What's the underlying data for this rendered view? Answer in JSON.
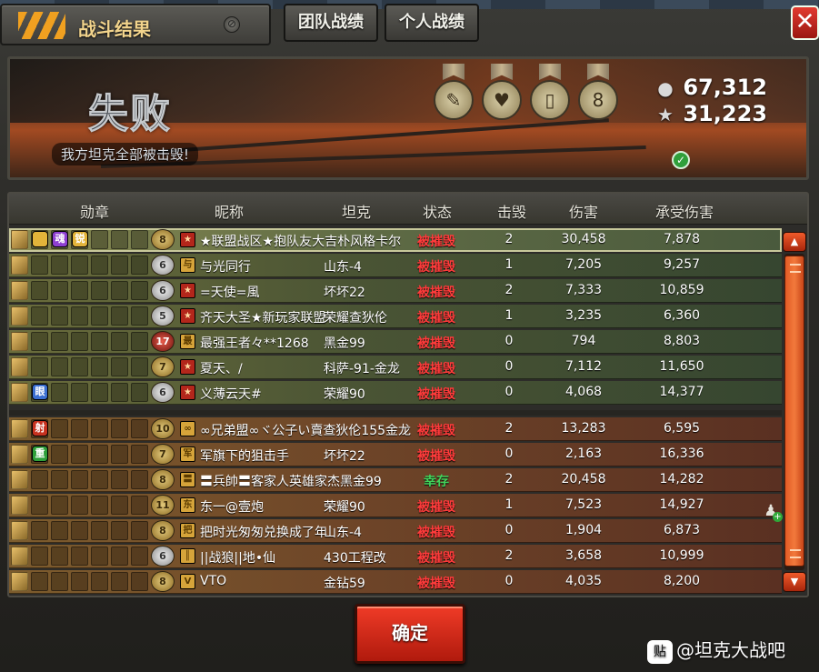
{
  "window": {
    "title": "战斗结果",
    "tabs": [
      "团队战绩",
      "个人战绩"
    ],
    "close_icon": "close-icon"
  },
  "banner": {
    "result": "失败",
    "subtitle": "我方坦克全部被击毁!",
    "medals": [
      "medal-map-icon",
      "medal-heart-icon",
      "medal-card-icon",
      "medal-vip-icon"
    ],
    "silver": "67,312",
    "stars": "31,223"
  },
  "table": {
    "headers": [
      "勋章",
      "昵称",
      "坦克",
      "状态",
      "击毁",
      "伤害",
      "承受伤害"
    ],
    "team_rows": [
      {
        "badges": [
          "gold",
          "purple",
          "gold"
        ],
        "badge_text": [
          "",
          "魂",
          "锐"
        ],
        "rank": "8",
        "rank_style": "gold",
        "clan": "★",
        "clan_style": "red",
        "name": "★联盟战区★抱队友大吉朴风格卡尔",
        "tank": "",
        "status": "被摧毁",
        "kills": "2",
        "damage": "30,458",
        "taken": "7,878",
        "selected": true
      },
      {
        "badges": [],
        "badge_text": [],
        "rank": "6",
        "rank_style": "silver",
        "clan": "与",
        "clan_style": "gold",
        "name": "与光同行",
        "tank": "山东-4",
        "status": "被摧毁",
        "kills": "1",
        "damage": "7,205",
        "taken": "9,257"
      },
      {
        "badges": [],
        "badge_text": [],
        "rank": "6",
        "rank_style": "silver",
        "clan": "★",
        "clan_style": "red",
        "name": "=天使=風",
        "tank": "坏坏22",
        "status": "被摧毁",
        "kills": "2",
        "damage": "7,333",
        "taken": "10,859"
      },
      {
        "badges": [],
        "badge_text": [],
        "rank": "5",
        "rank_style": "silver",
        "clan": "★",
        "clan_style": "red",
        "name": "齐天大圣★新玩家联盟",
        "tank": "荣耀查狄伦",
        "status": "被摧毁",
        "kills": "1",
        "damage": "3,235",
        "taken": "6,360"
      },
      {
        "badges": [],
        "badge_text": [],
        "rank": "17",
        "rank_style": "red",
        "clan": "最",
        "clan_style": "gold",
        "name": "最强王者々**1268",
        "tank": "黑金99",
        "status": "被摧毁",
        "kills": "0",
        "damage": "794",
        "taken": "8,803"
      },
      {
        "badges": [],
        "badge_text": [],
        "rank": "7",
        "rank_style": "gold",
        "clan": "★",
        "clan_style": "red",
        "name": "夏天、/",
        "tank": "科萨-91-金龙",
        "status": "被摧毁",
        "kills": "0",
        "damage": "7,112",
        "taken": "11,650"
      },
      {
        "badges": [
          "blue"
        ],
        "badge_text": [
          "眼"
        ],
        "rank": "6",
        "rank_style": "silver",
        "clan": "★",
        "clan_style": "red",
        "name": "义薄云天#",
        "tank": "荣耀90",
        "status": "被摧毁",
        "kills": "0",
        "damage": "4,068",
        "taken": "14,377"
      }
    ],
    "enemy_rows": [
      {
        "badges": [
          "red"
        ],
        "badge_text": [
          "射"
        ],
        "rank": "10",
        "rank_style": "gold",
        "clan": "∞",
        "clan_style": "gold",
        "name": "∞兄弟盟∞ヾ公子い賣查狄伦155金龙",
        "tank": "",
        "status": "被摧毁",
        "kills": "2",
        "damage": "13,283",
        "taken": "6,595"
      },
      {
        "badges": [
          "green"
        ],
        "badge_text": [
          "重"
        ],
        "rank": "7",
        "rank_style": "gold",
        "clan": "军",
        "clan_style": "gold",
        "name": "军旗下的狙击手",
        "tank": "坏坏22",
        "status": "被摧毁",
        "kills": "0",
        "damage": "2,163",
        "taken": "16,336"
      },
      {
        "badges": [],
        "badge_text": [],
        "rank": "8",
        "rank_style": "gold",
        "clan": "〓",
        "clan_style": "gold",
        "name": "〓兵帥〓客家人英雄家杰黑金99",
        "tank": "",
        "status": "幸存",
        "kills": "2",
        "damage": "20,458",
        "taken": "14,282"
      },
      {
        "badges": [],
        "badge_text": [],
        "rank": "11",
        "rank_style": "gold",
        "clan": "东",
        "clan_style": "gold",
        "name": "东一@壹炮",
        "tank": "荣耀90",
        "status": "被摧毁",
        "kills": "1",
        "damage": "7,523",
        "taken": "14,927"
      },
      {
        "badges": [],
        "badge_text": [],
        "rank": "8",
        "rank_style": "gold",
        "clan": "把",
        "clan_style": "gold",
        "name": "把时光匆匆兑换成了年",
        "tank": "山东-4",
        "status": "被摧毁",
        "kills": "0",
        "damage": "1,904",
        "taken": "6,873"
      },
      {
        "badges": [],
        "badge_text": [],
        "rank": "6",
        "rank_style": "silver",
        "clan": "║",
        "clan_style": "gold",
        "name": "||战狼||地•仙",
        "tank": "430工程改",
        "status": "被摧毁",
        "kills": "2",
        "damage": "3,658",
        "taken": "10,999"
      },
      {
        "badges": [],
        "badge_text": [],
        "rank": "8",
        "rank_style": "gold",
        "clan": "V",
        "clan_style": "gold",
        "name": "VTO",
        "tank": "金钻59",
        "status": "被摧毁",
        "kills": "0",
        "damage": "4,035",
        "taken": "8,200"
      }
    ]
  },
  "confirm_label": "确定",
  "watermark": "@坦克大战吧",
  "watermark_logo": "贴",
  "colors": {
    "destroyed": "#ff3b3b",
    "survived": "#42d35b",
    "accent": "#ef3b27"
  }
}
